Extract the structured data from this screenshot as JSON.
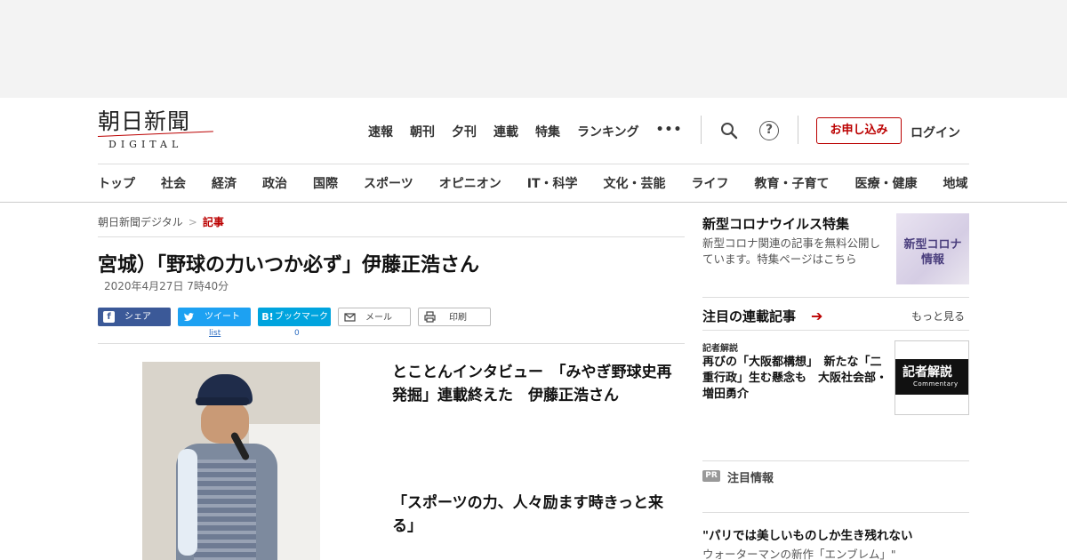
{
  "header": {
    "logo_jp": "朝日新聞",
    "logo_en": "DIGITAL",
    "topnav": [
      "速報",
      "朝刊",
      "夕刊",
      "連載",
      "特集",
      "ランキング"
    ],
    "more_label": "•••",
    "help_label": "?",
    "subscribe_label": "お申し込み",
    "login_label": "ログイン",
    "categories": [
      "トップ",
      "社会",
      "経済",
      "政治",
      "国際",
      "スポーツ",
      "オピニオン",
      "IT・科学",
      "文化・芸能",
      "ライフ",
      "教育・子育て",
      "医療・健康",
      "地域"
    ]
  },
  "breadcrumb": {
    "home": "朝日新聞デジタル",
    "sep": ">",
    "current": "記事"
  },
  "article": {
    "title": "宮城）「野球の力いつか必ず」伊藤正浩さん",
    "date": "2020年4月27日 7時40分",
    "share": {
      "facebook": "シェア",
      "twitter": "ツイート",
      "twitter_count": "list",
      "hatena": "ブックマーク",
      "hatena_icon": "B!",
      "hatena_count": "0",
      "mail": "メール",
      "print": "印刷"
    },
    "lead1": "とことんインタビュー　「みやぎ野球史再発掘」連載終えた　伊藤正浩さん",
    "lead2": "「スポーツの力、人々励ます時きっと来る」"
  },
  "sidebar": {
    "corona": {
      "heading": "新型コロナウイルス特集",
      "text": "新型コロナ関連の記事を無料公開しています。特集ページはこちら",
      "thumb_line1": "新型コロナ",
      "thumb_line2": "情報"
    },
    "series": {
      "heading": "注目の連載記事",
      "arrow": "➔",
      "more": "もっと見る",
      "tag": "記者解説",
      "text": "再びの「大阪都構想」　新たな「二重行政」生む懸念も　大阪社会部・増田勇介",
      "thumb_title": "記者解説",
      "thumb_sub": "Commentary"
    },
    "pr": {
      "badge": "PR",
      "label": "注目情報",
      "title": "\"パリでは美しいものしか生き残れない",
      "sub": "ウォーターマンの新作「エンブレム」\""
    }
  },
  "colors": {
    "brand_red": "#bb0000",
    "facebook": "#3b5998",
    "twitter": "#1da1f2",
    "hatena": "#00a4de"
  }
}
